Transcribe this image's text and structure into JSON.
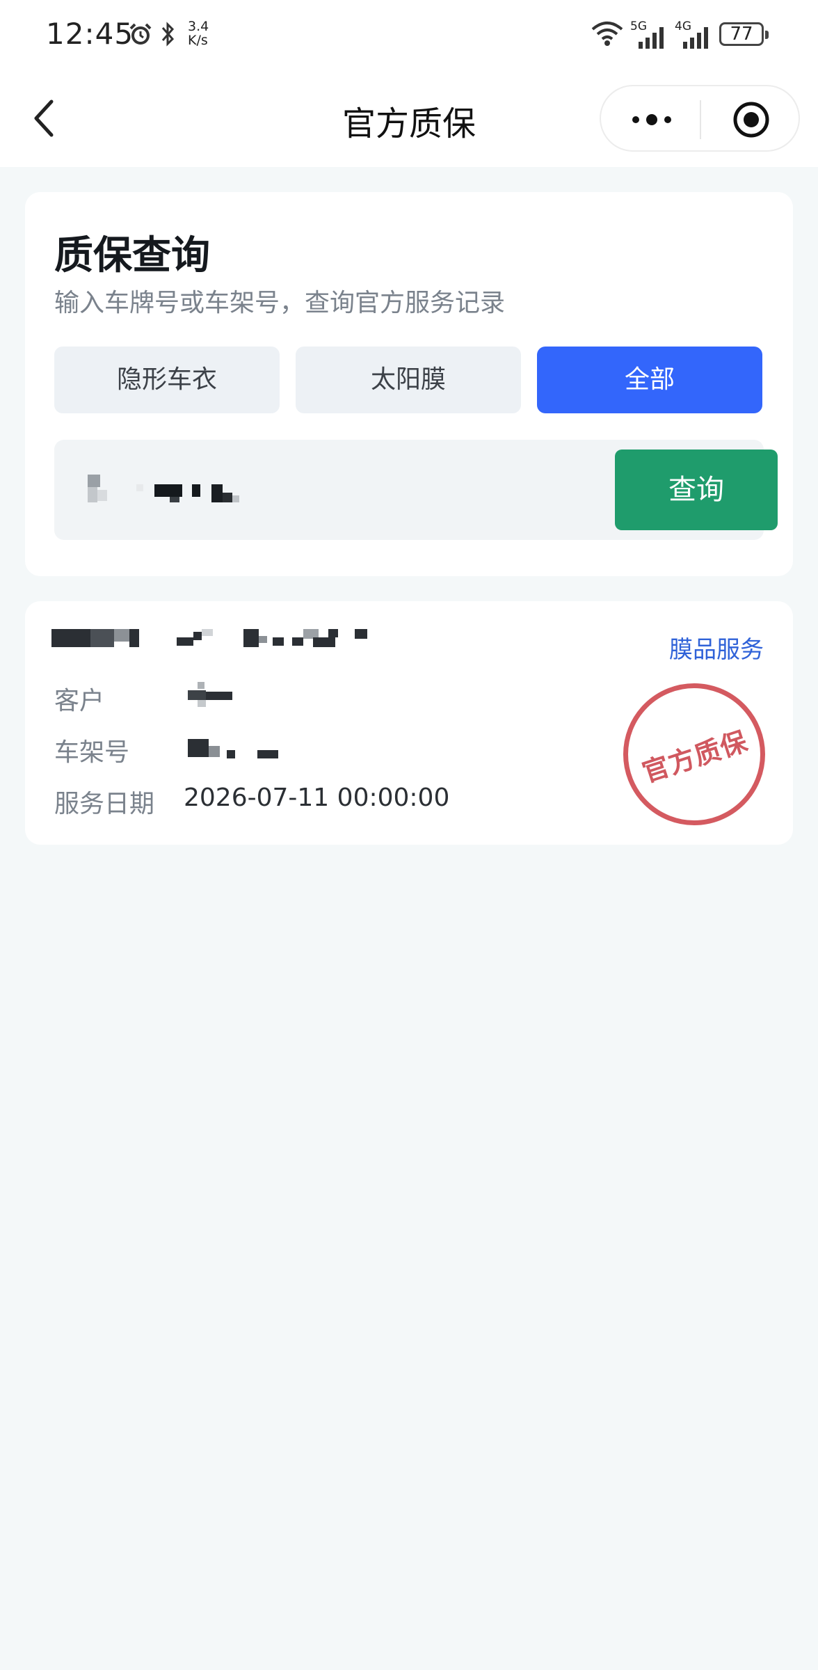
{
  "status_bar": {
    "time": "12:45",
    "net_speed_value": "3.4",
    "net_speed_unit": "K/s",
    "sig1_label": "5G",
    "sig2_label": "4G",
    "battery": "77"
  },
  "nav": {
    "title": "官方质保"
  },
  "query": {
    "title": "质保查询",
    "subtitle": "输入车牌号或车架号，查询官方服务记录",
    "tabs": [
      {
        "label": "隐形车衣",
        "active": false
      },
      {
        "label": "太阳膜",
        "active": false
      },
      {
        "label": "全部",
        "active": true
      }
    ],
    "search_button": "查询"
  },
  "result": {
    "service_type": "膜品服务",
    "customer_label": "客户",
    "vin_label": "车架号",
    "date_label": "服务日期",
    "date_value": "2026-07-11 00:00:00",
    "stamp": "官方质保"
  },
  "colors": {
    "accent_blue": "#3366fb",
    "search_green": "#1f9c6c",
    "stamp_red": "#d45a60",
    "link_blue": "#2f62d8"
  }
}
